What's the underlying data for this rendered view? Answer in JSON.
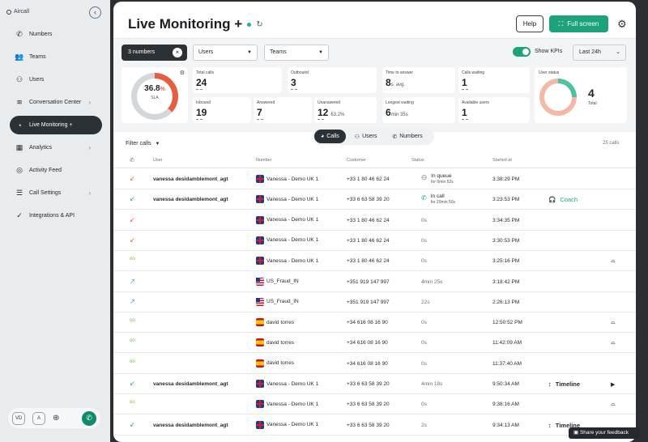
{
  "sidebar": {
    "brand": "Aircall",
    "collapse_icon": "chevron-left-icon",
    "items": [
      {
        "label": "Numbers",
        "icon": "phone-icon",
        "chevron": false,
        "active": false
      },
      {
        "label": "Teams",
        "icon": "teams-icon",
        "chevron": false,
        "active": false
      },
      {
        "label": "Users",
        "icon": "users-icon",
        "chevron": false,
        "active": false
      },
      {
        "label": "Conversation Center",
        "icon": "waveform-icon",
        "chevron": true,
        "active": false
      },
      {
        "label": "Live Monitoring +",
        "icon": "live-monitoring-icon",
        "chevron": false,
        "active": true
      },
      {
        "label": "Analytics",
        "icon": "analytics-icon",
        "chevron": true,
        "active": false
      },
      {
        "label": "Activity Feed",
        "icon": "activity-feed-icon",
        "chevron": false,
        "active": false
      },
      {
        "label": "Call Settings",
        "icon": "call-settings-icon",
        "chevron": true,
        "active": false
      },
      {
        "label": "Integrations & API",
        "icon": "integrations-icon",
        "chevron": false,
        "active": false
      }
    ],
    "bottom": {
      "avatar_initials": "VD",
      "status_letter": "A"
    }
  },
  "header": {
    "title": "Live Monitoring +",
    "help_label": "Help",
    "fullscreen_label": "Full screen"
  },
  "filters": {
    "numbers_chip": "3 numbers",
    "users_select": "Users",
    "teams_select": "Teams",
    "show_kpis_label": "Show KPIs",
    "show_kpis_on": true,
    "period": "Last 24h"
  },
  "kpis": {
    "sla": {
      "value": "36.8",
      "unit": "%",
      "label": "SLA",
      "fraction": 0.368
    },
    "total_calls": {
      "label": "Total calls",
      "value": "24"
    },
    "outbound": {
      "label": "Outbound",
      "value": "3"
    },
    "time_to_answer": {
      "label": "Time to answer",
      "value": "8",
      "unit": "s",
      "suffix": "avg."
    },
    "calls_waiting": {
      "label": "Calls waiting",
      "value": "1"
    },
    "inbound": {
      "label": "Inbound",
      "value": "19"
    },
    "answered": {
      "label": "Answered",
      "value": "7"
    },
    "unanswered": {
      "label": "Unanswered",
      "value": "12",
      "suffix": "63.2%"
    },
    "longest_waiting": {
      "label": "Longest waiting",
      "value": "6",
      "unit": "min 35s"
    },
    "available_users": {
      "label": "Available users",
      "value": "1"
    },
    "user_status": {
      "label": "User status",
      "value": "4",
      "sub": "Total"
    }
  },
  "table": {
    "filter_label": "Filter calls",
    "tabs": [
      {
        "label": "Calls",
        "active": true
      },
      {
        "label": "Users",
        "active": false
      },
      {
        "label": "Numbers",
        "active": false
      }
    ],
    "count": "25 calls",
    "headers": {
      "user": "User",
      "number": "Number",
      "customer": "Customer",
      "status": "Status",
      "started": "Started at"
    },
    "rows": [
      {
        "dir": "incoming",
        "user": "vanessa desidamblemont_agt",
        "flag": "uk",
        "number": "Vanessa - Demo UK 1",
        "customer": "+33 1 80 46 62 24",
        "status": "In queue",
        "status_sub": "for 6min 52s",
        "status_icon": "queue-icon",
        "started": "3:38:29 PM",
        "action": "",
        "end": ""
      },
      {
        "dir": "answered",
        "user": "vanessa desidamblemont_agt",
        "flag": "uk",
        "number": "Vanessa - Demo UK 1",
        "customer": "+33 6 63 58 39 20",
        "status": "In call",
        "status_sub": "for 20min 50s",
        "status_icon": "in-call-icon",
        "started": "3:23:53 PM",
        "action": "Coach",
        "end": ""
      },
      {
        "dir": "missed",
        "user": "",
        "flag": "uk",
        "number": "Vanessa - Demo UK 1",
        "customer": "+33 1 80 46 62 24",
        "status": "0s",
        "status_sub": "",
        "status_icon": "",
        "started": "3:34:35 PM",
        "action": "",
        "end": ""
      },
      {
        "dir": "missed",
        "user": "",
        "flag": "uk",
        "number": "Vanessa - Demo UK 1",
        "customer": "+33 1 80 46 62 24",
        "status": "0s",
        "status_sub": "",
        "status_icon": "",
        "started": "3:30:53 PM",
        "action": "",
        "end": ""
      },
      {
        "dir": "voicemail",
        "user": "",
        "flag": "uk",
        "number": "Vanessa - Demo UK 1",
        "customer": "+33 1 80 46 62 24",
        "status": "0s",
        "status_sub": "",
        "status_icon": "",
        "started": "3:25:16 PM",
        "action": "",
        "end": "voicemail"
      },
      {
        "dir": "outgoing",
        "user": "",
        "flag": "us",
        "number": "US_Fraud_IN",
        "customer": "+351 919 147 997",
        "status": "4min 25s",
        "status_sub": "",
        "status_icon": "",
        "started": "3:18:42 PM",
        "action": "",
        "end": ""
      },
      {
        "dir": "outgoing",
        "user": "",
        "flag": "us",
        "number": "US_Fraud_IN",
        "customer": "+351 919 147 997",
        "status": "22s",
        "status_sub": "",
        "status_icon": "",
        "started": "2:26:13 PM",
        "action": "",
        "end": ""
      },
      {
        "dir": "voicemail",
        "user": "",
        "flag": "es",
        "number": "david torres",
        "customer": "+34 616 08 16 90",
        "status": "0s",
        "status_sub": "",
        "status_icon": "",
        "started": "12:50:52 PM",
        "action": "",
        "end": "voicemail"
      },
      {
        "dir": "voicemail",
        "user": "",
        "flag": "es",
        "number": "david torres",
        "customer": "+34 616 08 16 90",
        "status": "0s",
        "status_sub": "",
        "status_icon": "",
        "started": "11:42:09 AM",
        "action": "",
        "end": "voicemail"
      },
      {
        "dir": "voicemail",
        "user": "",
        "flag": "es",
        "number": "david torres",
        "customer": "+34 616 08 16 90",
        "status": "0s",
        "status_sub": "",
        "status_icon": "",
        "started": "11:37:40 AM",
        "action": "",
        "end": ""
      },
      {
        "dir": "answered",
        "user": "vanessa desidamblemont_agt",
        "flag": "uk",
        "number": "Vanessa - Demo UK 1",
        "customer": "+33 6 63 58 39 20",
        "status": "4min 18s",
        "status_sub": "",
        "status_icon": "",
        "started": "9:50:34 AM",
        "action": "Timeline",
        "end": "play"
      },
      {
        "dir": "voicemail",
        "user": "",
        "flag": "uk",
        "number": "Vanessa - Demo UK 1",
        "customer": "+33 6 63 58 39 20",
        "status": "0s",
        "status_sub": "",
        "status_icon": "",
        "started": "9:38:16 AM",
        "action": "",
        "end": "voicemail"
      },
      {
        "dir": "answered",
        "user": "vanessa desidamblemont_agt",
        "flag": "uk",
        "number": "Vanessa - Demo UK 1",
        "customer": "+33 6 63 58 39 20",
        "status": "2s",
        "status_sub": "",
        "status_icon": "",
        "started": "9:34:13 AM",
        "action": "Timeline",
        "end": ""
      }
    ]
  },
  "feedback_label": "Share your feedback"
}
